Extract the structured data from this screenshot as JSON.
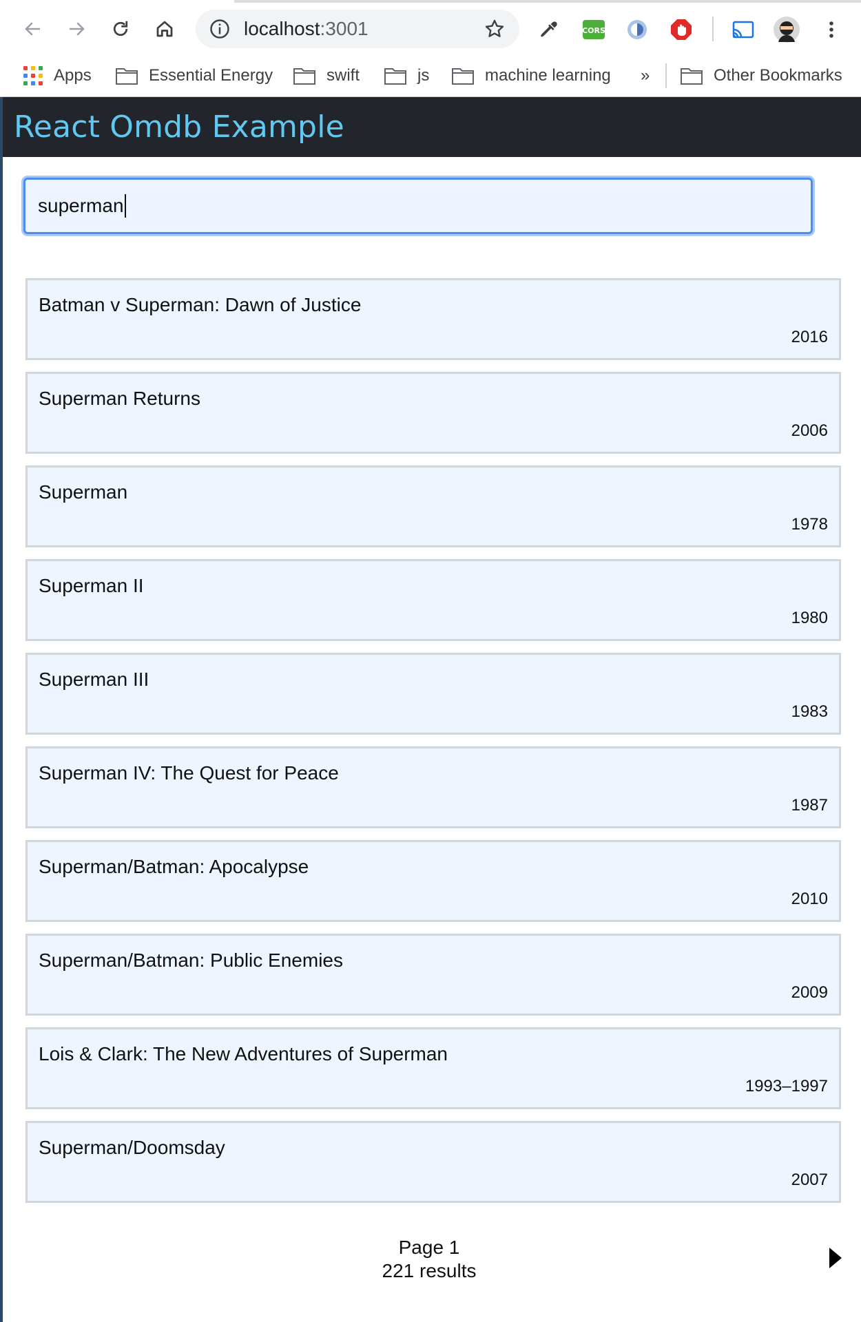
{
  "browser": {
    "url_host": "localhost",
    "url_port": ":3001",
    "bookmarks": [
      {
        "label": "Apps",
        "icon": "apps-grid-icon"
      },
      {
        "label": "Essential Energy",
        "icon": "folder-icon"
      },
      {
        "label": "swift",
        "icon": "folder-icon"
      },
      {
        "label": "js",
        "icon": "folder-icon"
      },
      {
        "label": "machine learning",
        "icon": "folder-icon"
      }
    ],
    "overflow_label": "»",
    "other_bookmarks": "Other Bookmarks",
    "extension_cors_label": "CORS"
  },
  "app": {
    "title": "React Omdb Example",
    "accent_color": "#61c8f0",
    "header_color": "#22262c"
  },
  "search": {
    "value": "superman"
  },
  "results": [
    {
      "title": "Batman v Superman: Dawn of Justice",
      "year": "2016"
    },
    {
      "title": "Superman Returns",
      "year": "2006"
    },
    {
      "title": "Superman",
      "year": "1978"
    },
    {
      "title": "Superman II",
      "year": "1980"
    },
    {
      "title": "Superman III",
      "year": "1983"
    },
    {
      "title": "Superman IV: The Quest for Peace",
      "year": "1987"
    },
    {
      "title": "Superman/Batman: Apocalypse",
      "year": "2010"
    },
    {
      "title": "Superman/Batman: Public Enemies",
      "year": "2009"
    },
    {
      "title": "Lois & Clark: The New Adventures of Superman",
      "year": "1993–1997"
    },
    {
      "title": "Superman/Doomsday",
      "year": "2007"
    }
  ],
  "pagination": {
    "page_label": "Page 1",
    "results_label": "221 results"
  }
}
